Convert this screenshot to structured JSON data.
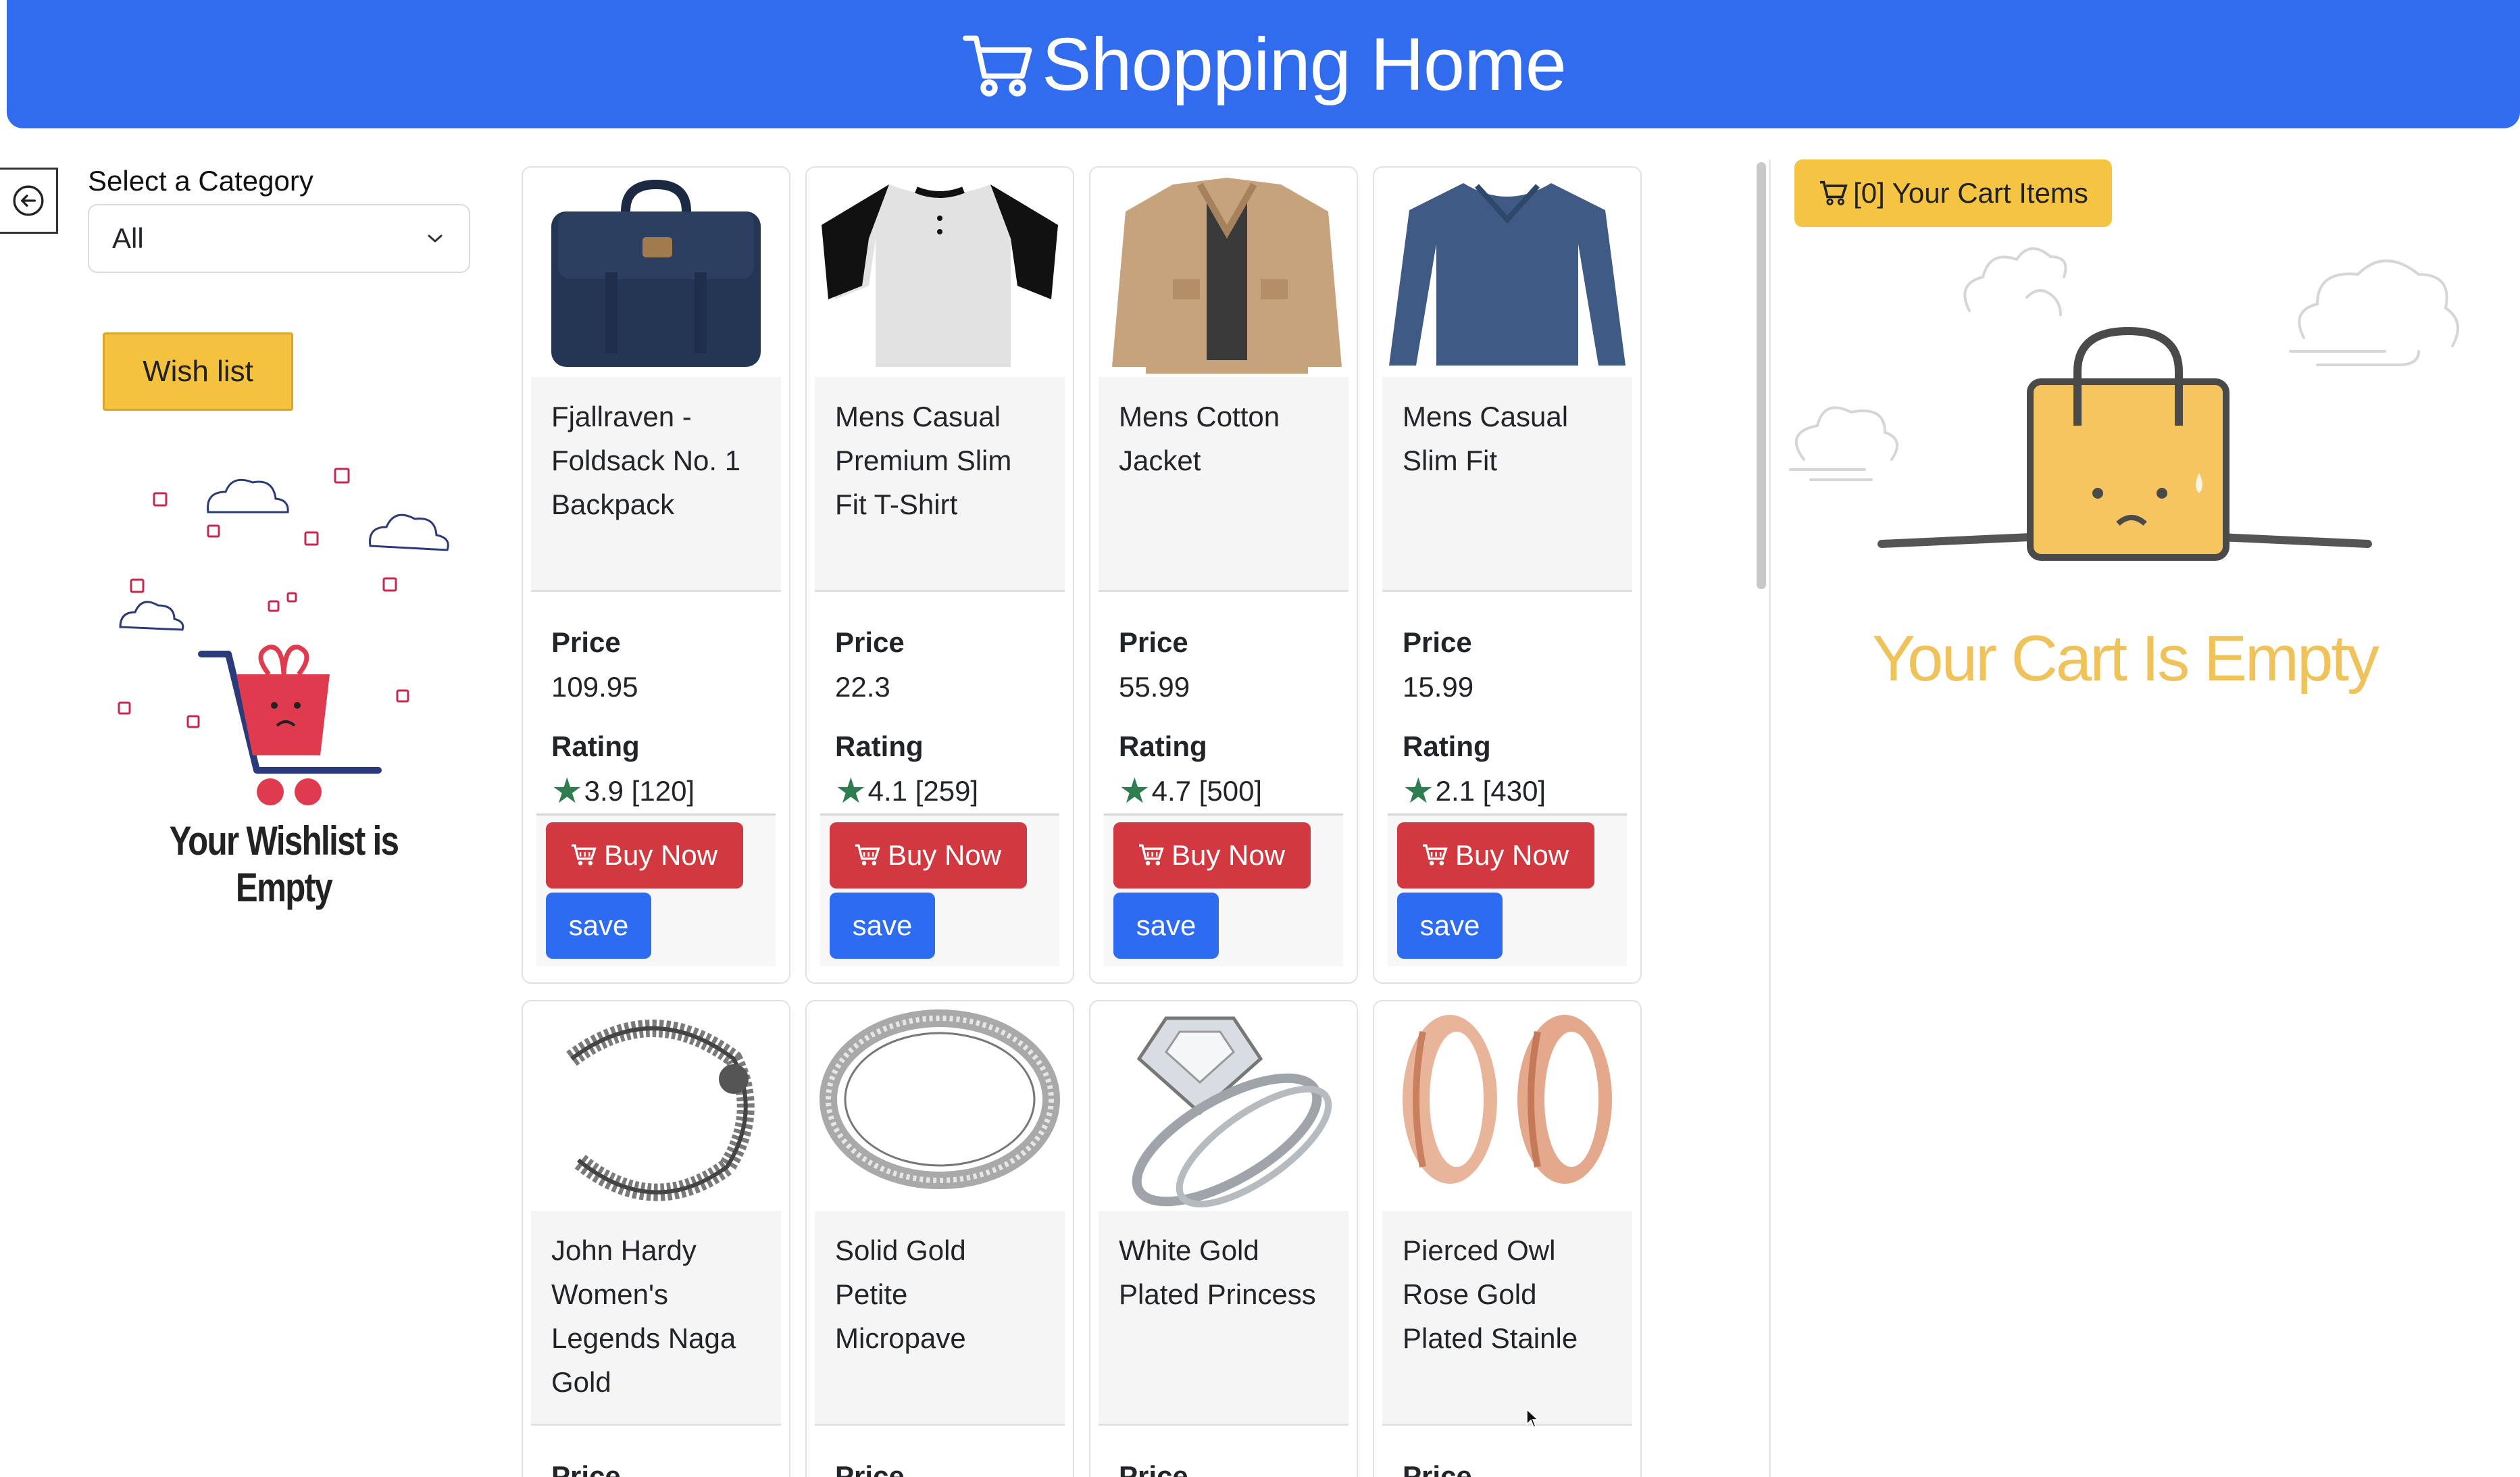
{
  "header": {
    "title": "Shopping Home",
    "icon": "cart-icon",
    "color": "#316bee"
  },
  "sidebar": {
    "category_label": "Select a Category",
    "category_selected": "All",
    "wishlist_button": "Wish list",
    "wishlist_empty_text": "Your Wishlist is Empty"
  },
  "products": [
    {
      "title": "Fjallraven - Foldsack No. 1 Backpack",
      "price_label": "Price",
      "price": "109.95",
      "rating_label": "Rating",
      "rating": "3.9 [120]",
      "buy_label": "Buy Now",
      "save_label": "save",
      "image": "backpack"
    },
    {
      "title": "Mens Casual Premium Slim Fit T-Shirt",
      "price_label": "Price",
      "price": "22.3",
      "rating_label": "Rating",
      "rating": "4.1 [259]",
      "buy_label": "Buy Now",
      "save_label": "save",
      "image": "tshirt"
    },
    {
      "title": "Mens Cotton Jacket",
      "price_label": "Price",
      "price": "55.99",
      "rating_label": "Rating",
      "rating": "4.7 [500]",
      "buy_label": "Buy Now",
      "save_label": "save",
      "image": "jacket"
    },
    {
      "title": "Mens Casual Slim Fit",
      "price_label": "Price",
      "price": "15.99",
      "rating_label": "Rating",
      "rating": "2.1 [430]",
      "buy_label": "Buy Now",
      "save_label": "save",
      "image": "longsleeve"
    },
    {
      "title": "John Hardy Women's Legends Naga Gold",
      "price_label": "Price",
      "image": "bracelet"
    },
    {
      "title": "Solid Gold Petite Micropave",
      "price_label": "Price",
      "image": "ring"
    },
    {
      "title": "White Gold Plated Princess",
      "price_label": "Price",
      "image": "diamond-ring"
    },
    {
      "title": "Pierced Owl Rose Gold Plated Stainle",
      "price_label": "Price",
      "image": "rose-gold-plugs"
    }
  ],
  "cart": {
    "button_label": "[0] Your Cart Items",
    "empty_text": "Your Cart Is Empty"
  },
  "colors": {
    "buy": "#d2383f",
    "save": "#2d6cf0",
    "wishlist": "#f4c23f",
    "star": "#2e7d4f"
  }
}
